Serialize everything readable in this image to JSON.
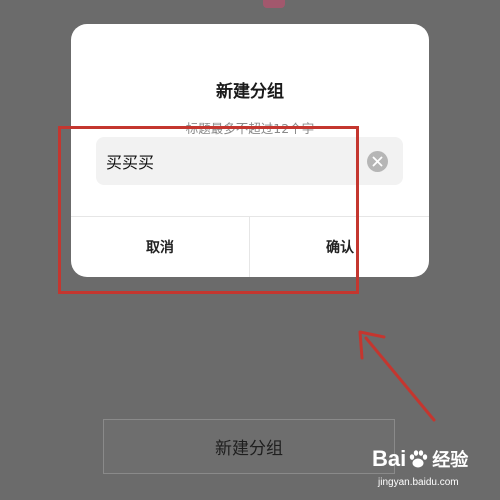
{
  "dialog": {
    "title": "新建分组",
    "hint": "标题最多不超过12个字",
    "input_value": "买买买",
    "cancel_label": "取消",
    "confirm_label": "确认"
  },
  "background": {
    "button_label": "新建分组"
  },
  "watermark": {
    "logo_prefix": "Bai",
    "logo_suffix": "经验",
    "url": "jingyan.baidu.com"
  },
  "colors": {
    "overlay": "#6b6b6b",
    "dialog_bg": "#ffffff",
    "annotation_red": "#c4362f",
    "clear_icon": "#b6b6b6"
  },
  "icons": {
    "clear": "clear-icon",
    "arrow": "annotation-arrow",
    "paw": "paw-icon"
  }
}
